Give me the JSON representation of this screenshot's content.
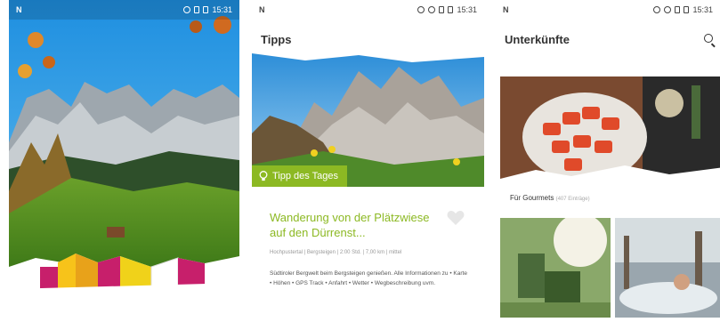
{
  "screen1": {
    "status_time": "15:31"
  },
  "screen2": {
    "status_time": "15:31",
    "header_title": "Tipps",
    "tip_badge": "Tipp des Tages",
    "tip_title": "Wanderung von der Plätzwiese auf den Dürrenst...",
    "tip_meta": "Hochpustertal | Bergsteigen | 2:00 Std. | 7,00 km | mittel",
    "tip_description": "Südtiroler Bergwelt beim Bergsteigen genießen. Alle Informationen zu • Karte • Höhen • GPS Track • Anfahrt • Wetter • Wegbeschreibung uvm."
  },
  "screen3": {
    "status_time": "15:31",
    "header_title": "Unterkünfte",
    "category_label": "Für Gourmets",
    "category_count": "(407 Einträge)"
  },
  "colors": {
    "accent_green": "#8cb923",
    "sky_blue": "#2b9be0"
  }
}
